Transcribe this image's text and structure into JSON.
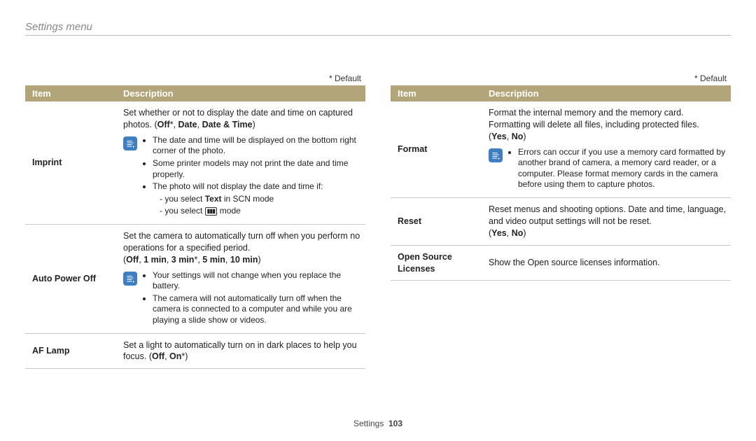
{
  "header": {
    "section_title": "Settings menu"
  },
  "default_label": "* Default",
  "table_headers": {
    "item": "Item",
    "description": "Description"
  },
  "left": {
    "imprint": {
      "item": "Imprint",
      "desc_pre": "Set whether or not to display the date and time on captured photos. (",
      "opt1": "Off",
      "sep1": "*, ",
      "opt2": "Date",
      "sep2": ", ",
      "opt3": "Date & Time",
      "desc_post": ")",
      "note1": "The date and time will be displayed on the bottom right corner of the photo.",
      "note2": "Some printer models may not print the date and time properly.",
      "note3": "The photo will not display the date and time if:",
      "sub1_pre": "you select ",
      "sub1_bold": "Text",
      "sub1_post": " in SCN mode",
      "sub2_pre": "you select ",
      "sub2_post": " mode"
    },
    "autopower": {
      "item": "Auto Power Off",
      "desc_pre": "Set the camera to automatically turn off when you perform no operations for a specified period.",
      "opts_open": "(",
      "o1": "Off",
      "s1": ", ",
      "o2": "1 min",
      "s2": ", ",
      "o3": "3 min",
      "s3": "*, ",
      "o4": "5 min",
      "s4": ", ",
      "o5": "10 min",
      "opts_close": ")",
      "note1": "Your settings will not change when you replace the battery.",
      "note2": "The camera will not automatically turn off when the camera is connected to a computer and while you are playing a slide show or videos."
    },
    "aflamp": {
      "item": "AF Lamp",
      "desc_pre": "Set a light to automatically turn on in dark places to help you focus. (",
      "o1": "Off",
      "s1": ", ",
      "o2": "On",
      "desc_post": "*)"
    }
  },
  "right": {
    "format": {
      "item": "Format",
      "desc_pre": "Format the internal memory and the memory card. Formatting will delete all files, including protected files.",
      "opts_open": "(",
      "o1": "Yes",
      "s1": ", ",
      "o2": "No",
      "opts_close": ")",
      "note1": "Errors can occur if you use a memory card formatted by another brand of camera, a memory card reader, or a computer. Please format memory cards in the camera before using them to capture photos."
    },
    "reset": {
      "item": "Reset",
      "desc_pre": "Reset menus and shooting options. Date and time, language, and video output settings will not be reset.",
      "opts_open": "(",
      "o1": "Yes",
      "s1": ", ",
      "o2": "No",
      "opts_close": ")"
    },
    "osl": {
      "item": "Open Source Licenses",
      "desc": "Show the Open source licenses information."
    }
  },
  "footer": {
    "section": "Settings",
    "page": "103"
  }
}
